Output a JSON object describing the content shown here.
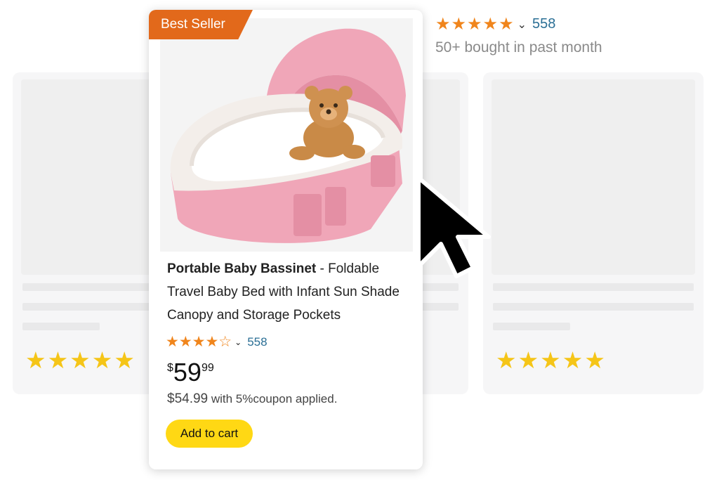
{
  "badge": {
    "label": "Best Seller"
  },
  "top_listing": {
    "stars": "★★★★★",
    "chevron": "⌄",
    "rating_count": "558",
    "bought_text": "50+ bought in past month"
  },
  "background_cards": [
    {
      "stars": "★★★★★"
    },
    {
      "stars": "★★★★★"
    }
  ],
  "product": {
    "title_bold": "Portable Baby Bassinet",
    "title_rest": " - Foldable Travel Baby Bed with Infant Sun Shade Canopy and Storage Pockets",
    "stars": "★★★★☆",
    "rating_value": 4.5,
    "chevron": "⌄",
    "rating_count": "558",
    "price_symbol": "$",
    "price_whole": "59",
    "price_fraction": "99",
    "coupon_price": "$54.99",
    "coupon_text": " with 5%coupon applied.",
    "add_to_cart": "Add to cart"
  },
  "colors": {
    "badge": "#e2691b",
    "stars": "#f0851c",
    "link": "#2b6f95",
    "button": "#ffd814",
    "bg_stars": "#f5c518",
    "bassinet_pink": "#f0a6b8"
  },
  "icons": [
    "star-icon",
    "chevron-down-icon",
    "mouse-pointer-icon"
  ]
}
